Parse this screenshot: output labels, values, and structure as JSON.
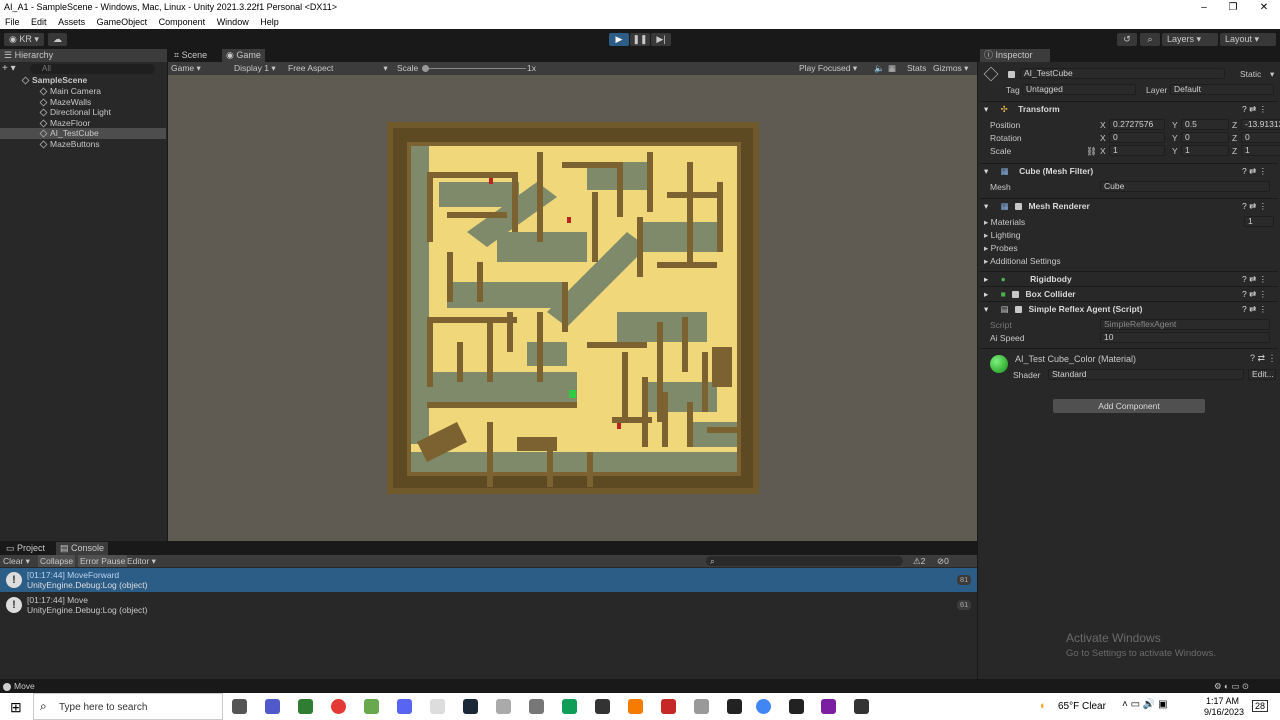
{
  "window": {
    "title": "AI_A1 - SampleScene - Windows, Mac, Linux - Unity 2021.3.22f1 Personal <DX11>"
  },
  "menu": [
    "File",
    "Edit",
    "Assets",
    "GameObject",
    "Component",
    "Window",
    "Help"
  ],
  "toolbar": {
    "account": "KR",
    "layers": "Layers",
    "layout": "Layout"
  },
  "hierarchy": {
    "tab": "Hierarchy",
    "search_placeholder": "All",
    "scene": "SampleScene",
    "items": [
      "Main Camera",
      "MazeWalls",
      "Directional Light",
      "MazeFloor",
      "AI_TestCube",
      "MazeButtons"
    ]
  },
  "game": {
    "tabs": [
      "Scene",
      "Game"
    ],
    "display_mode": "Game",
    "display": "Display 1",
    "aspect": "Free Aspect",
    "scale_label": "Scale",
    "scale_value": "1x",
    "play_focused": "Play Focused",
    "stats": "Stats",
    "gizmos": "Gizmos"
  },
  "inspector": {
    "tab": "Inspector",
    "object_name": "AI_TestCube",
    "static_label": "Static",
    "tag_label": "Tag",
    "tag_value": "Untagged",
    "layer_label": "Layer",
    "layer_value": "Default",
    "transform": {
      "title": "Transform",
      "position_label": "Position",
      "rotation_label": "Rotation",
      "scale_label": "Scale",
      "position": {
        "x": "0.2727576",
        "y": "0.5",
        "z": "-13.91313"
      },
      "rotation": {
        "x": "0",
        "y": "0",
        "z": "0"
      },
      "scale": {
        "x": "1",
        "y": "1",
        "z": "1"
      }
    },
    "mesh_filter": {
      "title": "Cube (Mesh Filter)",
      "mesh_label": "Mesh",
      "mesh_value": "Cube"
    },
    "mesh_renderer": {
      "title": "Mesh Renderer",
      "materials": "Materials",
      "materials_count": "1",
      "lighting": "Lighting",
      "probes": "Probes",
      "additional": "Additional Settings"
    },
    "rigidbody": "Rigidbody",
    "box_collider": "Box Collider",
    "script": {
      "title": "Simple Reflex Agent (Script)",
      "script_label": "Script",
      "script_value": "SimpleReflexAgent",
      "speed_label": "Ai Speed",
      "speed_value": "10"
    },
    "material": {
      "title": "AI_Test Cube_Color (Material)",
      "shader_label": "Shader",
      "shader_value": "Standard",
      "edit": "Edit..."
    },
    "add_component": "Add Component"
  },
  "console": {
    "tabs": [
      "Project",
      "Console"
    ],
    "clear": "Clear",
    "collapse": "Collapse",
    "error_pause": "Error Pause",
    "editor": "Editor",
    "warn_count": "2",
    "err_count": "0",
    "logs": [
      {
        "line1": "[01:17:44] MoveForward",
        "line2": "UnityEngine.Debug:Log (object)",
        "count": "81"
      },
      {
        "line1": "[01:17:44] Move",
        "line2": "UnityEngine.Debug:Log (object)",
        "count": "61"
      }
    ]
  },
  "statusbar": {
    "text": "Move"
  },
  "watermark": {
    "line1": "Activate Windows",
    "line2": "Go to Settings to activate Windows."
  },
  "taskbar": {
    "search_placeholder": "Type here to search",
    "weather": "65°F  Clear",
    "time": "1:17 AM",
    "date": "9/16/2023",
    "notif": "28"
  },
  "colors": {
    "accent": "#2c5d87",
    "floor": "#f0d77a",
    "wall": "#7d6231",
    "shadow": "#7f8a6a"
  }
}
